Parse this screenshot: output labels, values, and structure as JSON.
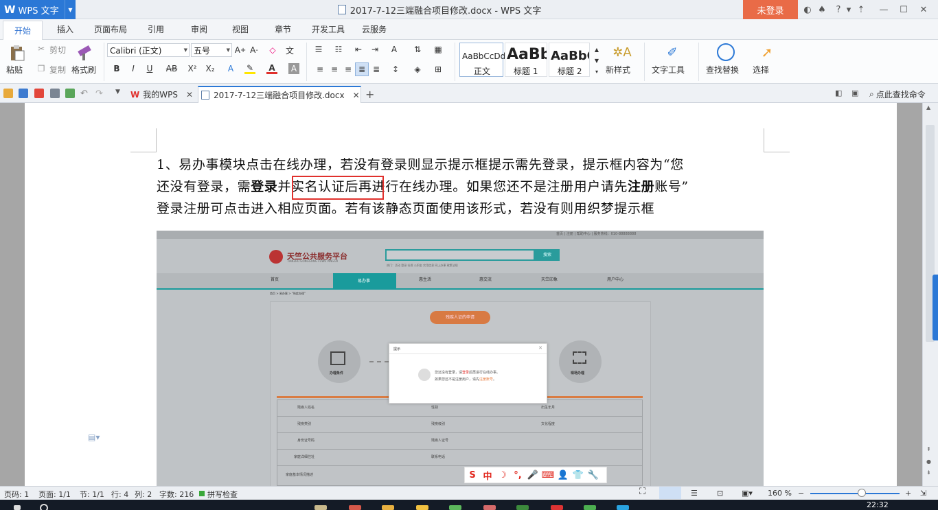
{
  "app": {
    "name": "WPS 文字",
    "logo_letter": "W",
    "login_label": "未登录"
  },
  "window": {
    "title": "2017-7-12三端融合项目修改.docx - WPS 文字"
  },
  "ribbon_tabs": [
    "开始",
    "插入",
    "页面布局",
    "引用",
    "审阅",
    "视图",
    "章节",
    "开发工具",
    "云服务"
  ],
  "ribbon": {
    "paste": "粘贴",
    "cut": "剪切",
    "copy": "复制",
    "format_painter": "格式刷",
    "font_name": "Calibri (正文)",
    "font_size": "五号",
    "styles": [
      {
        "preview": "AaBbCcDd",
        "label": "正文"
      },
      {
        "preview": "AaBb",
        "label": "标题 1"
      },
      {
        "preview": "AaBbC",
        "label": "标题 2"
      }
    ],
    "new_style": "新样式",
    "text_tools": "文字工具",
    "find_replace": "查找替换",
    "select": "选择"
  },
  "doc_tabs": [
    {
      "label": "我的WPS"
    },
    {
      "label": "2017-7-12三端融合项目修改.docx"
    }
  ],
  "search_command": "点此查找命令",
  "document": {
    "lines": [
      {
        "t1": "1、易办事模块点击在线办理，若没有登录则显示提示框提示需先登录，提示框内容为“您"
      },
      {
        "t1": "还没有登录，需",
        "b1": "登录",
        "h1": "并实名认证后",
        "t2": "再进行在线办理。如果您还不是注册用户请先",
        "b2": "注册",
        "t3": "账号”"
      },
      {
        "t1": "登录注册可点击进入相应页面。若有该静态页面使用该形式，若没有则用织梦提示框"
      }
    ]
  },
  "screenshot": {
    "top_links": "首页  | 注册  | 帮助中心 | 服务热线：010-88888888",
    "site_name": "天竺公共服务平台",
    "site_sub": "TIANZHU GONGGONG FUWU PINGTAI",
    "search_button": "搜索",
    "hot_words": "热门：活动   登录   社保   公积金   实用信息   网上办事   政策法规",
    "nav": [
      "首页",
      "易办事",
      "惠生活",
      "惠交流",
      "天竺印象",
      "用户中心"
    ],
    "breadcrumb": "首页 > 易办事 > “残疾办理”",
    "apply_button": "残疾人证的申请",
    "step_left": "办理条件",
    "step_right": "现场办理",
    "dialog": {
      "title": "提示",
      "line1_a": "您还没有登录，请",
      "line1_b": "登录",
      "line1_c": "后再进行在线办事。",
      "line2_a": "如果您还不是注册用户，请先",
      "line2_b": "注册账号",
      "line2_c": "。"
    },
    "form_rows": [
      [
        "残疾人姓名",
        "性别",
        "出生年月"
      ],
      [
        "残疾类别",
        "残疾级别",
        "文化程度"
      ],
      [
        "身份证号码",
        "残疾人证号",
        ""
      ],
      [
        "家庭详细住址",
        "联系电话",
        ""
      ],
      [
        "家庭基本情况描述",
        "",
        ""
      ]
    ]
  },
  "status_bar": {
    "page_num": "页码: 1",
    "pages": "页面: 1/1",
    "section": "节: 1/1",
    "row": "行: 4",
    "col": "列: 2",
    "word_count": "字数: 216",
    "spell_check": "拼写检查",
    "zoom": "160 %"
  },
  "ime": {
    "items": [
      "S",
      "中",
      "☽",
      "°,",
      "🎤",
      "⌨",
      "👤",
      "👕",
      "🔧"
    ]
  },
  "clock": "22:32",
  "colors": {
    "accent": "#2b78d6",
    "login": "#e96b47",
    "highlight_border": "#e0302c",
    "teal": "#1a9b9c",
    "orange": "#e97b3d"
  }
}
